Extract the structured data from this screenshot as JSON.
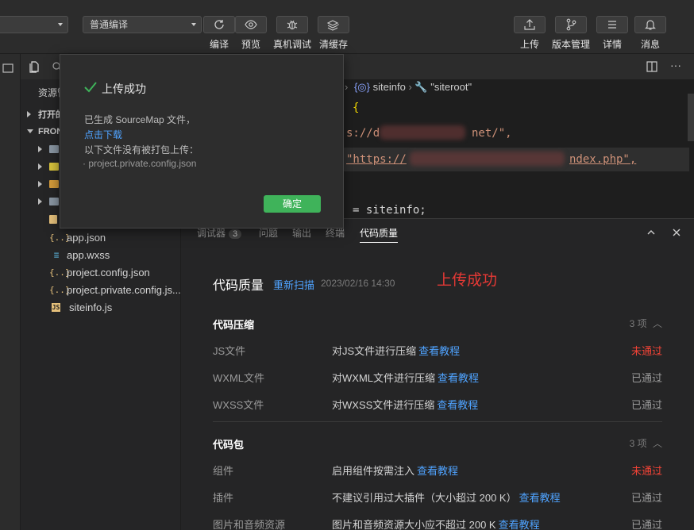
{
  "toolbar": {
    "left_select": "",
    "compile_mode": "普通编译",
    "buttons": [
      {
        "label": "编译",
        "icon": "refresh-icon"
      },
      {
        "label": "预览",
        "icon": "eye-icon"
      },
      {
        "label": "真机调试",
        "icon": "bug-icon"
      },
      {
        "label": "清缓存",
        "icon": "layers-icon"
      }
    ],
    "right_buttons": [
      {
        "label": "上传",
        "icon": "upload-icon"
      },
      {
        "label": "版本管理",
        "icon": "branch-icon"
      },
      {
        "label": "详情",
        "icon": "menu-icon"
      },
      {
        "label": "消息",
        "icon": "bell-icon"
      }
    ]
  },
  "sidebar": {
    "tab_label": "资源管",
    "open_editors": "打开的",
    "project_root": "FRON",
    "files": [
      {
        "icon": "json",
        "name": "app.json"
      },
      {
        "icon": "css",
        "name": "app.wxss"
      },
      {
        "icon": "json",
        "name": "project.config.json"
      },
      {
        "icon": "json",
        "name": "project.private.config.js..."
      },
      {
        "icon": "js",
        "name": "siteinfo.js"
      }
    ]
  },
  "editor": {
    "breadcrumb": [
      "siteinfo",
      "\"siteroot\""
    ],
    "code_lines": [
      "{",
      "s://d",
      "net/\",",
      "\"https://",
      "ndex.php\",",
      "= siteinfo;"
    ]
  },
  "panel": {
    "tabs": [
      {
        "label": "调试器",
        "badge": "3"
      },
      {
        "label": "问题"
      },
      {
        "label": "输出"
      },
      {
        "label": "终端"
      },
      {
        "label": "代码质量",
        "active": true
      }
    ],
    "title": "代码质量",
    "rescan": "重新扫描",
    "timestamp": "2023/02/16 14:30",
    "annotation": "上传成功",
    "sections": [
      {
        "title": "代码压缩",
        "count": "3 项",
        "rows": [
          {
            "name": "JS文件",
            "desc": "对JS文件进行压缩",
            "link": "查看教程",
            "status": "未通过",
            "ok": false
          },
          {
            "name": "WXML文件",
            "desc": "对WXML文件进行压缩",
            "link": "查看教程",
            "status": "已通过",
            "ok": true
          },
          {
            "name": "WXSS文件",
            "desc": "对WXSS文件进行压缩",
            "link": "查看教程",
            "status": "已通过",
            "ok": true
          }
        ]
      },
      {
        "title": "代码包",
        "count": "3 项",
        "rows": [
          {
            "name": "组件",
            "desc": "启用组件按需注入",
            "link": "查看教程",
            "status": "未通过",
            "ok": false
          },
          {
            "name": "插件",
            "desc": "不建议引用过大插件（大小超过 200 K）",
            "link": "查看教程",
            "status": "已通过",
            "ok": true
          },
          {
            "name": "图片和音频资源",
            "desc": "图片和音频资源大小应不超过 200 K",
            "link": "查看教程",
            "status": "已通过",
            "ok": true
          }
        ]
      }
    ]
  },
  "popup": {
    "title": "上传成功",
    "line1": "已生成 SourceMap 文件，",
    "download_link": "点击下载",
    "line2": "以下文件没有被打包上传：",
    "file": "· project.private.config.json",
    "ok_button": "确定"
  },
  "colors": {
    "accent_link": "#4fa3ff",
    "fail": "#f44336",
    "ok_button": "#3fb35a",
    "success_check": "#3fb35a"
  }
}
